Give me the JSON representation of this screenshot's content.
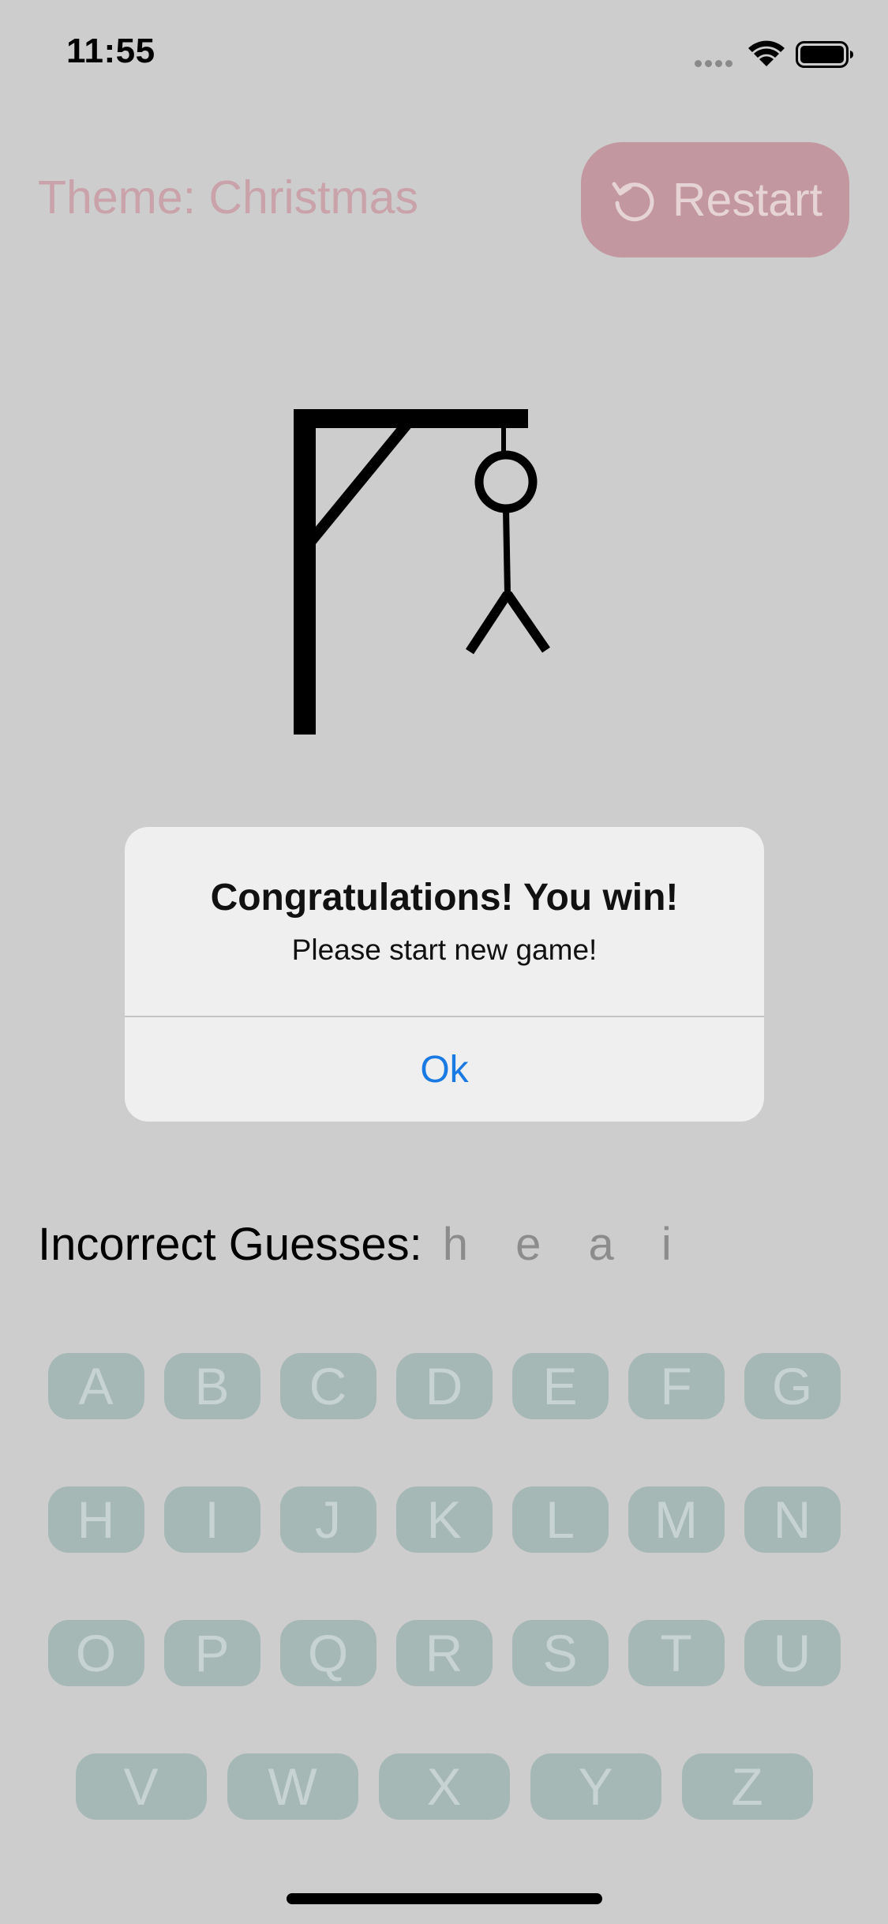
{
  "status_bar": {
    "time": "11:55",
    "signal_icon": "cellular-signal-icon",
    "wifi_icon": "wifi-icon",
    "battery_icon": "battery-icon"
  },
  "header": {
    "theme_label": "Theme: Christmas",
    "restart_label": "Restart",
    "restart_icon": "restart-arrow-icon"
  },
  "alert": {
    "title": "Congratulations! You win!",
    "message": "Please start new game!",
    "ok_label": "Ok"
  },
  "incorrect": {
    "label": "Incorrect Guesses:",
    "letters": "h e a i"
  },
  "keyboard": {
    "rows": [
      [
        "A",
        "B",
        "C",
        "D",
        "E",
        "F",
        "G"
      ],
      [
        "H",
        "I",
        "J",
        "K",
        "L",
        "M",
        "N"
      ],
      [
        "O",
        "P",
        "Q",
        "R",
        "S",
        "T",
        "U"
      ],
      [
        "V",
        "W",
        "X",
        "Y",
        "Z"
      ]
    ]
  },
  "colors": {
    "background": "#cdcdcd",
    "restart_button": "#c3979f",
    "theme_text": "#c9a2aa",
    "key_background": "#a6b8b6",
    "alert_button_text": "#1a7ae3"
  }
}
